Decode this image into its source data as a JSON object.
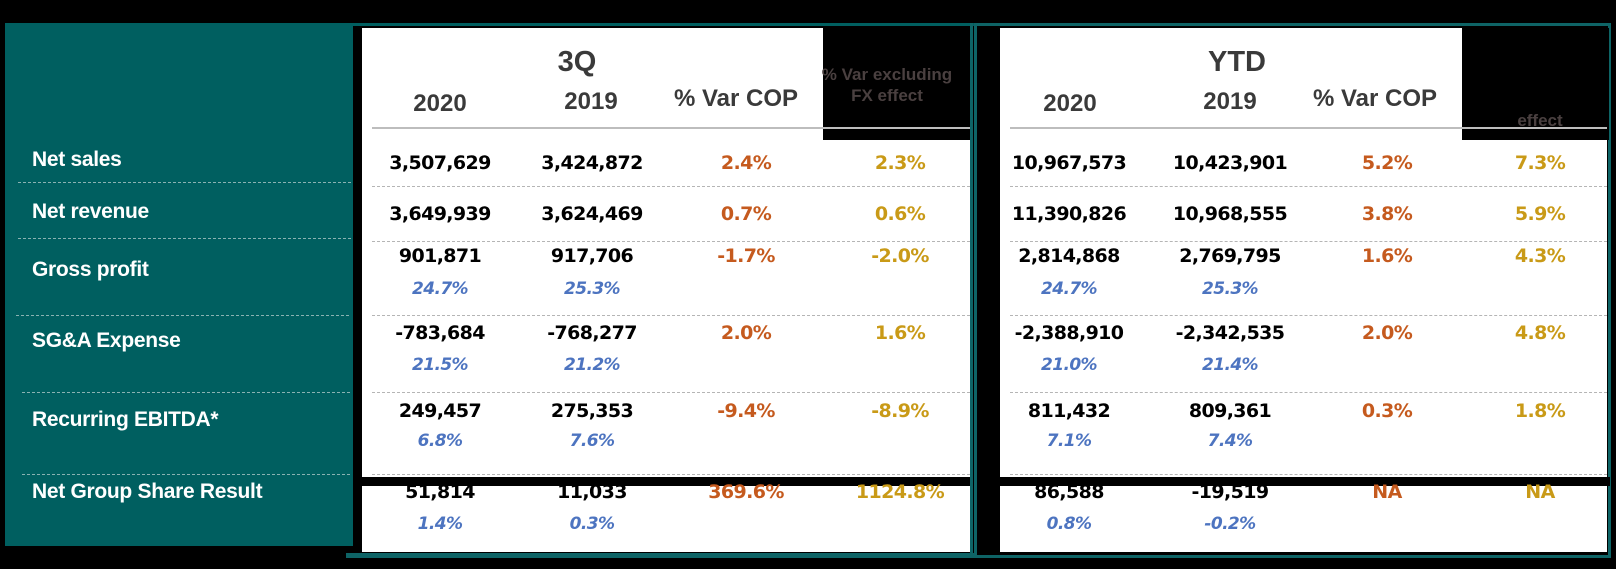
{
  "sections": {
    "q3": {
      "title": "3Q",
      "col_2020": "2020",
      "col_2019": "2019",
      "col_var": "% Var COP",
      "col_fx_line1": "% Var excluding",
      "col_fx_line2": "FX effect"
    },
    "ytd": {
      "title": "YTD",
      "col_2020": "2020",
      "col_2019": "2019",
      "col_var": "% Var COP",
      "col_fx": "effect"
    }
  },
  "rows": [
    {
      "label": "Net sales",
      "q3": {
        "v2020": "3,507,629",
        "v2019": "3,424,872",
        "var": "2.4%",
        "fx": "2.3%"
      },
      "ytd": {
        "v2020": "10,967,573",
        "v2019": "10,423,901",
        "var": "5.2%",
        "fx": "7.3%"
      }
    },
    {
      "label": "Net revenue",
      "q3": {
        "v2020": "3,649,939",
        "v2019": "3,624,469",
        "var": "0.7%",
        "fx": "0.6%"
      },
      "ytd": {
        "v2020": "11,390,826",
        "v2019": "10,968,555",
        "var": "3.8%",
        "fx": "5.9%"
      }
    },
    {
      "label": "Gross profit",
      "q3": {
        "v2020": "901,871",
        "v2019": "917,706",
        "var": "-1.7%",
        "fx": "-2.0%",
        "p2020": "24.7%",
        "p2019": "25.3%"
      },
      "ytd": {
        "v2020": "2,814,868",
        "v2019": "2,769,795",
        "var": "1.6%",
        "fx": "4.3%",
        "p2020": "24.7%",
        "p2019": "25.3%"
      }
    },
    {
      "label": "SG&A Expense",
      "q3": {
        "v2020": "-783,684",
        "v2019": "-768,277",
        "var": "2.0%",
        "fx": "1.6%",
        "p2020": "21.5%",
        "p2019": "21.2%"
      },
      "ytd": {
        "v2020": "-2,388,910",
        "v2019": "-2,342,535",
        "var": "2.0%",
        "fx": "4.8%",
        "p2020": "21.0%",
        "p2019": "21.4%"
      }
    },
    {
      "label": "Recurring EBITDA*",
      "q3": {
        "v2020": "249,457",
        "v2019": "275,353",
        "var": "-9.4%",
        "fx": "-8.9%",
        "p2020": "6.8%",
        "p2019": "7.6%"
      },
      "ytd": {
        "v2020": "811,432",
        "v2019": "809,361",
        "var": "0.3%",
        "fx": "1.8%",
        "p2020": "7.1%",
        "p2019": "7.4%"
      }
    },
    {
      "label": "Net Group Share Result",
      "q3": {
        "v2020": "51,814",
        "v2019": "11,033",
        "var": "369.6%",
        "fx": "1124.8%",
        "p2020": "1.4%",
        "p2019": "0.3%"
      },
      "ytd": {
        "v2020": "86,588",
        "v2019": "-19,519",
        "var": "NA",
        "fx": "NA",
        "p2020": "0.8%",
        "p2019": "-0.2%"
      }
    }
  ],
  "colors": {
    "teal": "#005f60",
    "var_cop": "#c55a1e",
    "var_fx": "#c99a17",
    "ratio": "#4d74c0"
  }
}
